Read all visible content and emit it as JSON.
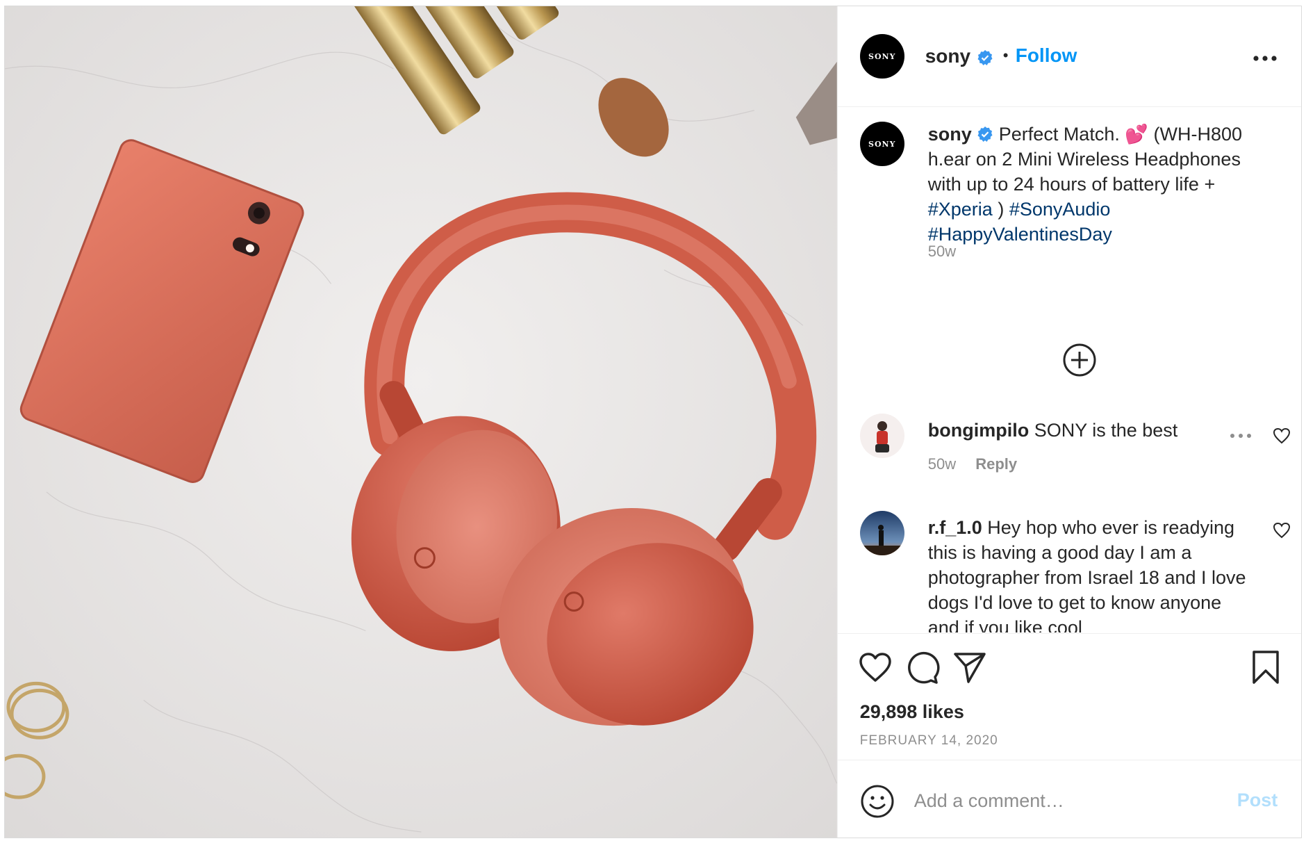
{
  "header": {
    "avatar_text": "SONY",
    "username": "sony",
    "separator": "•",
    "follow_label": "Follow"
  },
  "caption": {
    "avatar_text": "SONY",
    "username": "sony",
    "text_start": "Perfect Match.",
    "emoji": "💕",
    "text_middle": "(WH-H800 h.ear on 2 Mini Wireless Headphones with up to 24 hours of battery life +",
    "hashtag_1": "#Xperia",
    "text_paren": ")",
    "hashtag_2": "#SonyAudio",
    "hashtag_3": "#HappyValentinesDay",
    "time": "50w"
  },
  "comments": [
    {
      "username": "bongimpilo",
      "text": "SONY is the best",
      "time": "50w",
      "reply_label": "Reply"
    },
    {
      "username": "r.f_1.0",
      "text": "Hey hop who ever is readying this is having a good day I am a photographer from Israel 18 and I love dogs I'd love to get to know anyone and if you like cool"
    }
  ],
  "stats": {
    "likes": "29,898 likes",
    "date": "FEBRUARY 14, 2020"
  },
  "composer": {
    "placeholder": "Add a comment…",
    "post_label": "Post"
  },
  "colors": {
    "accent": "#0095f6",
    "hashtag": "#00376b",
    "muted": "#8e8e8e",
    "verified": "#3897f0",
    "post_disabled": "#b2dffc"
  },
  "icons": [
    "verified-badge-icon",
    "more-options-icon",
    "load-more-comments-icon",
    "heart-icon",
    "comment-icon",
    "share-icon",
    "bookmark-icon",
    "emoji-icon"
  ]
}
